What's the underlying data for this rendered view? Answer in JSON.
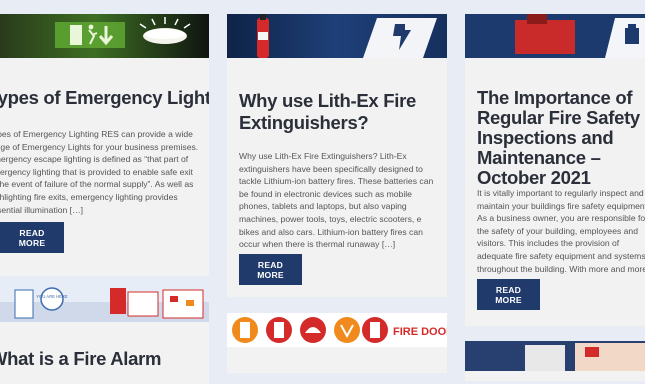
{
  "posts": [
    {
      "title": "Types of Emergency Lighting",
      "excerpt": "Types of Emergency Lighting RES can provide a wide range of Emergency Lights for your business premises. Emergency escape lighting is defined as “that part of emergency lighting that is provided to enable safe exit in the event of failure of the normal supply”. As well as highlighting fire exits, emergency lighting provides essential illumination […]",
      "read_more": "READ MORE"
    },
    {
      "title": "Why use Lith-Ex Fire Extinguishers?",
      "excerpt": "Why use Lith-Ex Fire Extinguishers? Lith-Ex extinguishers have been specifically designed to tackle Lithium-ion battery fires. These batteries can be found in electronic devices such as mobile phones, tablets and laptops, but also vaping machines, power tools, toys, electric scooters, e bikes and also cars. Lithium-ion battery fires can occur when there is thermal runaway […]",
      "read_more": "READ MORE"
    },
    {
      "title": "The Importance of Regular Fire Safety Inspections and Maintenance – October 2021",
      "excerpt": "It is vitally important to regularly inspect and maintain your buildings fire safety equipment. As a business owner, you are responsible for the safety of your building, employees and visitors. This includes the provision of adequate fire safety equipment and systems throughout the building. With more and more businesses returning to the office, it is […]",
      "read_more": "READ MORE"
    },
    {
      "title": "What is a Fire Alarm"
    },
    {
      "logo_text": "FIRE DOOR"
    }
  ],
  "plan_label": "YOU ARE HERE",
  "colors": {
    "button": "#1f3a6b",
    "card": "#f2f2f2",
    "page": "#e8ecf4",
    "accent_red": "#d42a2a",
    "accent_orange": "#f08a1c"
  }
}
